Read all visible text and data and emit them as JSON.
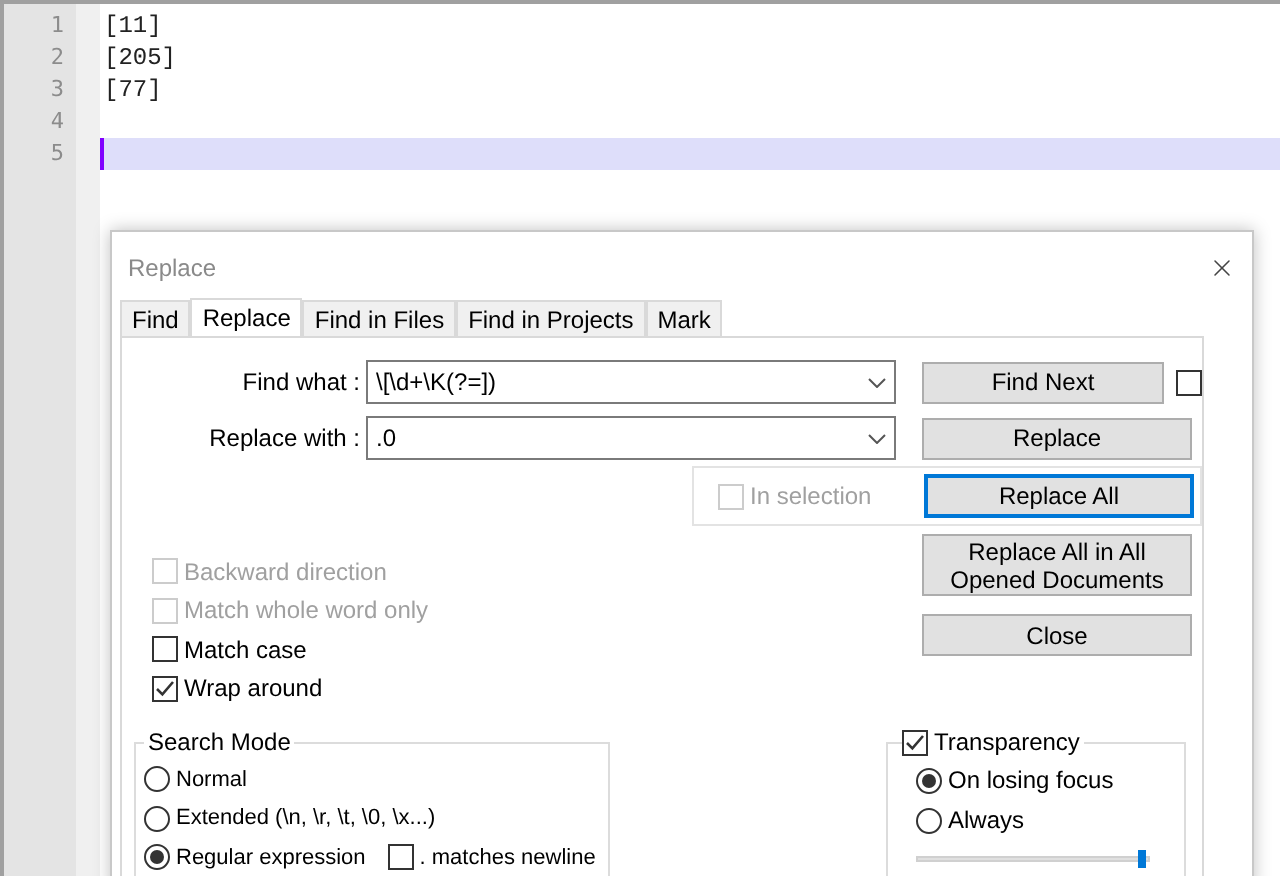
{
  "editor": {
    "lines": [
      {
        "number": "1",
        "text": "[11]",
        "current": false
      },
      {
        "number": "2",
        "text": "[205]",
        "current": false
      },
      {
        "number": "3",
        "text": "[77]",
        "current": false
      },
      {
        "number": "4",
        "current": false
      },
      {
        "number": "5",
        "current": true
      }
    ]
  },
  "dialog": {
    "title": "Replace",
    "tabs": [
      {
        "label": "Find",
        "selected": false
      },
      {
        "label": "Replace",
        "selected": true
      },
      {
        "label": "Find in Files",
        "selected": false
      },
      {
        "label": "Find in Projects",
        "selected": false
      },
      {
        "label": "Mark",
        "selected": false
      }
    ],
    "find_what": {
      "label": "Find what :",
      "value": "\\[\\d+\\K(?=])"
    },
    "replace_with": {
      "label": "Replace with :",
      "value": ".0"
    },
    "find_next": {
      "label": "Find Next",
      "focused": false
    },
    "replace": {
      "label": "Replace",
      "focused": false
    },
    "replace_all": {
      "label": "Replace All",
      "focused": true
    },
    "replace_all_opened": {
      "label": "Replace All in All Opened Documents",
      "focused": false
    },
    "close": {
      "label": "Close",
      "focused": false
    },
    "side_checkbox": {
      "checked": false
    },
    "in_selection": {
      "label": "In selection",
      "checked": false,
      "disabled": true
    },
    "options": [
      {
        "label": "Backward direction",
        "checked": false,
        "disabled": true
      },
      {
        "label": "Match whole word only",
        "checked": false,
        "disabled": true
      },
      {
        "label": "Match case",
        "checked": false,
        "disabled": false
      },
      {
        "label": "Wrap around",
        "checked": true,
        "disabled": false
      }
    ],
    "search_mode": {
      "title": "Search Mode",
      "modes": [
        {
          "label": "Normal",
          "selected": false
        },
        {
          "label": "Extended (\\n, \\r, \\t, \\0, \\x...)",
          "selected": false
        },
        {
          "label": "Regular expression",
          "selected": true
        }
      ],
      "dot_newline": {
        "label": ". matches newline",
        "checked": false
      }
    },
    "transparency": {
      "label": "Transparency",
      "checked": true,
      "modes": [
        {
          "label": "On losing focus",
          "selected": true
        },
        {
          "label": "Always",
          "selected": false
        }
      ],
      "level": 0.97
    }
  }
}
